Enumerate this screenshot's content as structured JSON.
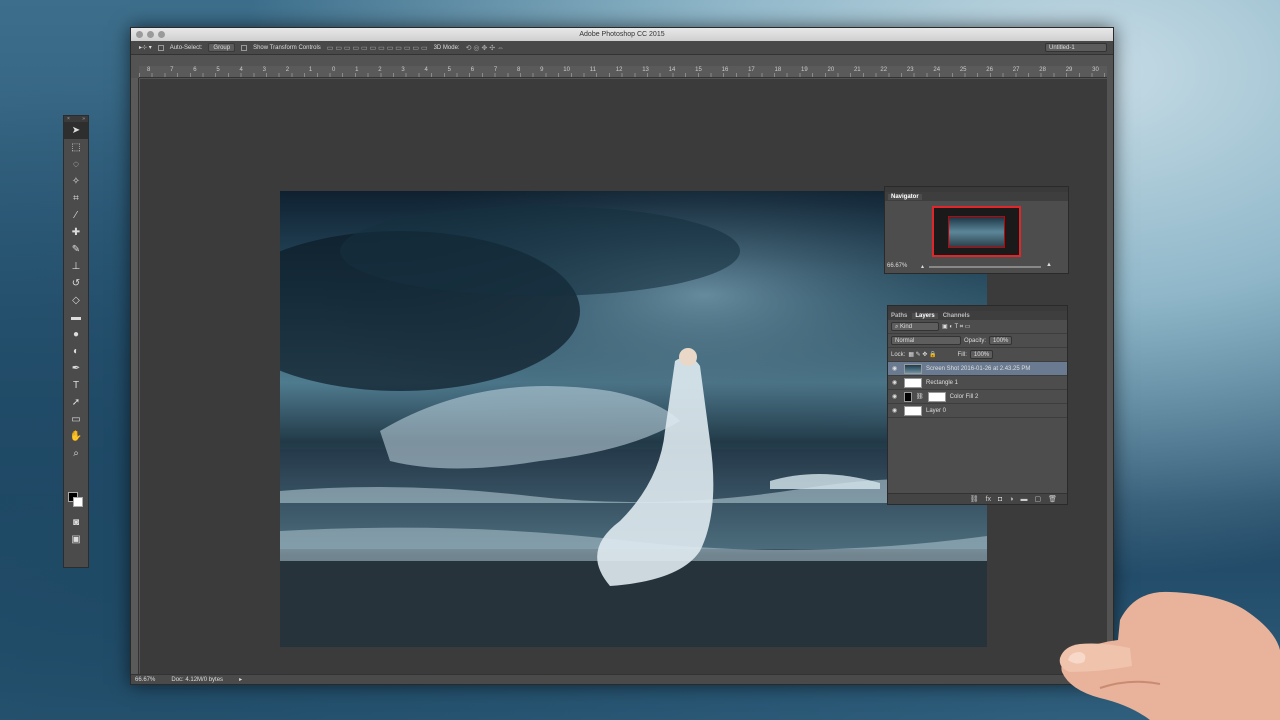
{
  "window": {
    "title": "Adobe Photoshop CC 2015",
    "document_tab": "Untitled-1"
  },
  "options_bar": {
    "auto_select_label": "Auto-Select:",
    "auto_select_value": "Group",
    "transform_label": "Show Transform Controls",
    "mode_3d_label": "3D Mode:"
  },
  "ruler_top": [
    "8",
    "7",
    "6",
    "5",
    "4",
    "3",
    "2",
    "1",
    "0",
    "1",
    "2",
    "3",
    "4",
    "5",
    "6",
    "7",
    "8",
    "9",
    "10",
    "11",
    "12",
    "13",
    "14",
    "15",
    "16",
    "17",
    "18",
    "19",
    "20",
    "21",
    "22",
    "23",
    "24",
    "25",
    "26",
    "27",
    "28",
    "29",
    "30"
  ],
  "status_bar": {
    "zoom": "66.67%",
    "doc": "Doc: 4.12M/0 bytes"
  },
  "navigator": {
    "title": "Navigator",
    "zoom": "66.67%"
  },
  "layers_panel": {
    "tabs": [
      "Paths",
      "Layers",
      "Channels"
    ],
    "active_tab": "Layers",
    "filter_kind": "Kind",
    "blend_mode": "Normal",
    "opacity_label": "Opacity:",
    "opacity_value": "100%",
    "lock_label": "Lock:",
    "fill_label": "Fill:",
    "fill_value": "100%",
    "layers": [
      {
        "name": "Screen Shot 2016-01-26 at 2.43.25 PM",
        "selected": true
      },
      {
        "name": "Rectangle 1",
        "selected": false
      },
      {
        "name": "Color Fill 2",
        "selected": false
      },
      {
        "name": "Layer 0",
        "selected": false
      }
    ]
  },
  "toolbar": {
    "tools": [
      "move-tool",
      "marquee-tool",
      "lasso-tool",
      "magic-wand-tool",
      "crop-tool",
      "eyedropper-tool",
      "healing-brush-tool",
      "brush-tool",
      "clone-stamp-tool",
      "history-brush-tool",
      "eraser-tool",
      "gradient-tool",
      "blur-tool",
      "dodge-tool",
      "pen-tool",
      "type-tool",
      "path-selection-tool",
      "rectangle-tool",
      "hand-tool",
      "zoom-tool"
    ]
  },
  "colors": {
    "accent": "#e0262a",
    "selected_layer": "#6a7a90",
    "canvas_bg": "#3b3b3b"
  }
}
